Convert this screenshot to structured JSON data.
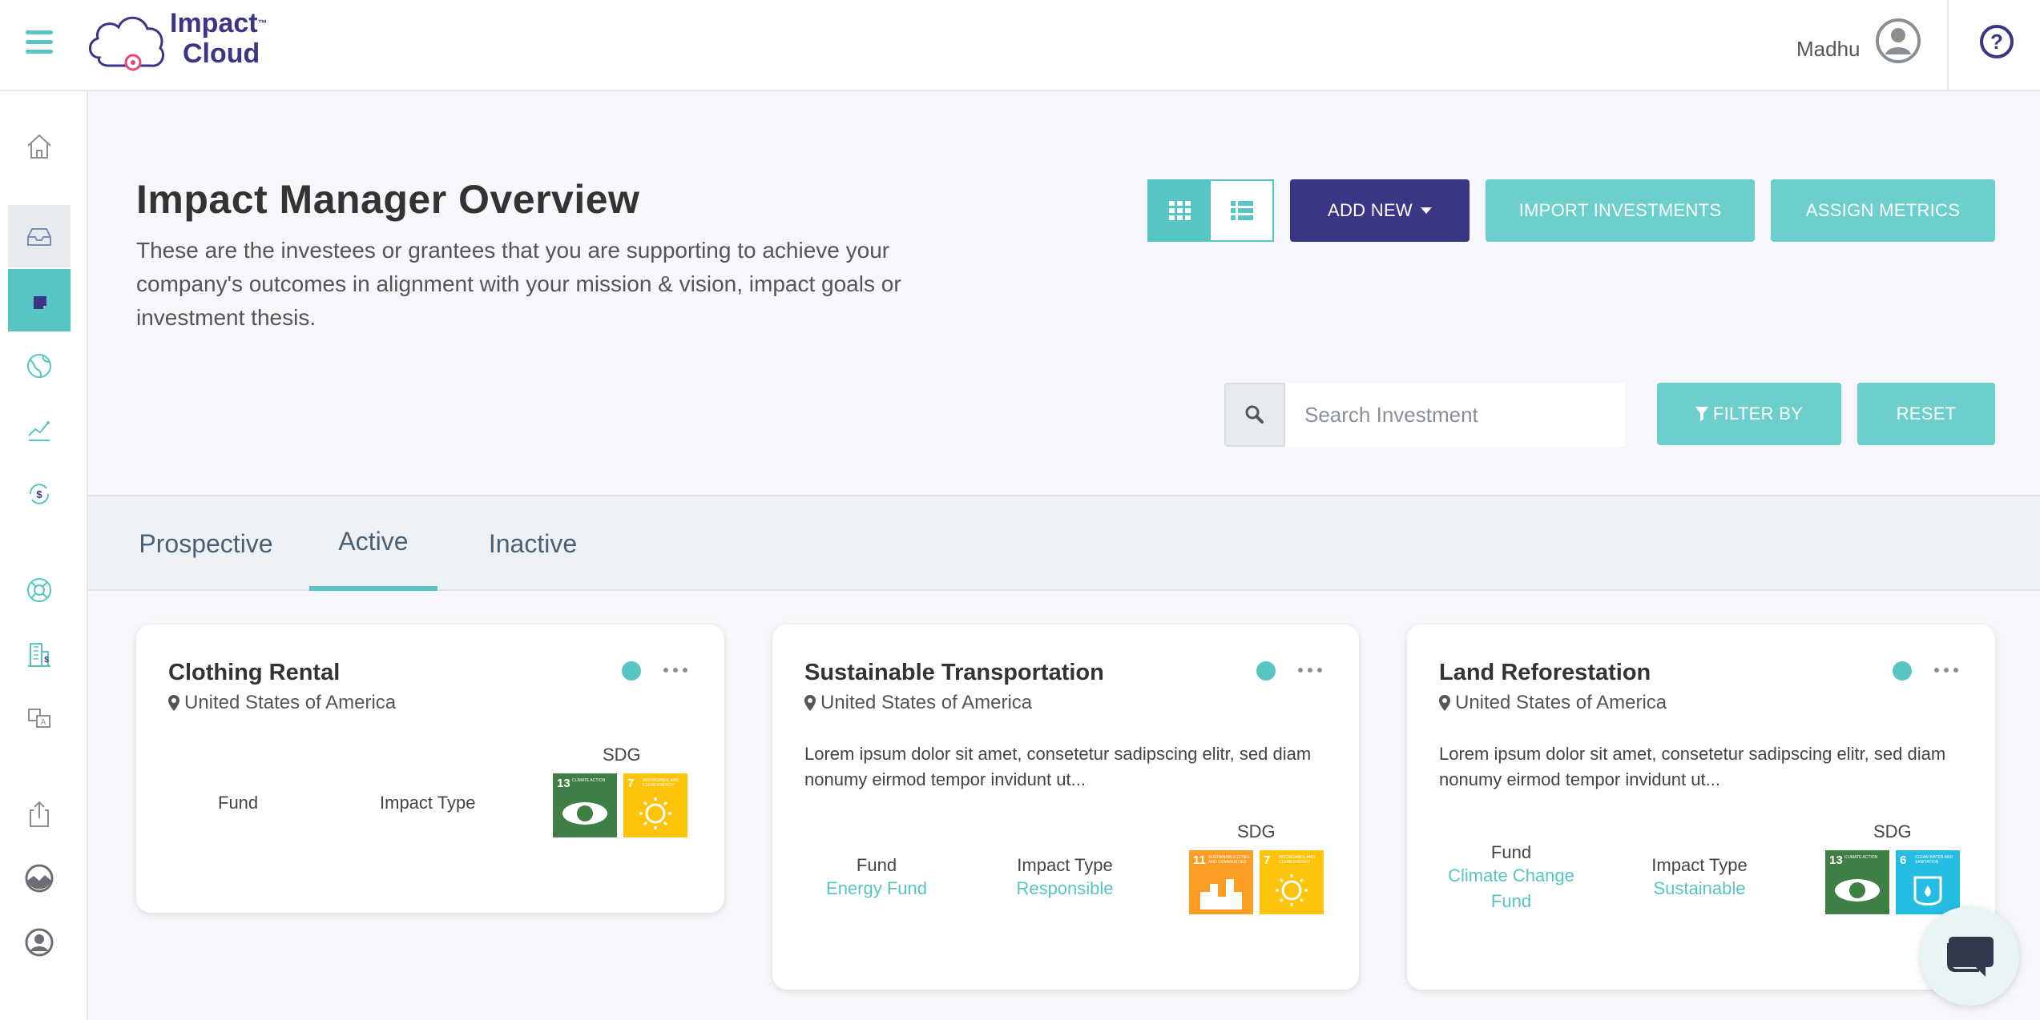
{
  "header": {
    "logo_line1": "Impact",
    "logo_line2": "Cloud",
    "logo_tm": "™",
    "user_name": "Madhu"
  },
  "sidebar": {
    "items": [
      {
        "icon": "home-icon"
      },
      {
        "icon": "inbox-icon"
      },
      {
        "icon": "document-icon"
      },
      {
        "icon": "globe-icon"
      },
      {
        "icon": "trend-chart-icon"
      },
      {
        "icon": "money-cycle-icon"
      },
      {
        "icon": "lifebuoy-icon"
      },
      {
        "icon": "building-icon"
      },
      {
        "icon": "translate-icon"
      },
      {
        "icon": "upload-icon"
      },
      {
        "icon": "landscape-icon"
      },
      {
        "icon": "profile-icon"
      }
    ],
    "active_index": 2
  },
  "page": {
    "title": "Impact Manager Overview",
    "description": "These are the investees or grantees that you are supporting to achieve your company's outcomes in alignment with your mission & vision, impact goals or investment thesis."
  },
  "toolbar": {
    "add_new_label": "ADD NEW",
    "import_label": "IMPORT INVESTMENTS",
    "assign_label": "ASSIGN METRICS",
    "filter_label": "FILTER BY",
    "reset_label": "RESET"
  },
  "search": {
    "placeholder": "Search Investment",
    "value": ""
  },
  "tabs": [
    {
      "label": "Prospective",
      "active": false
    },
    {
      "label": "Active",
      "active": true
    },
    {
      "label": "Inactive",
      "active": false
    }
  ],
  "cards": [
    {
      "title": "Clothing Rental",
      "location": "United States of America",
      "description": "",
      "fund_label": "Fund",
      "fund_value": "",
      "impact_label": "Impact Type",
      "impact_value": "",
      "sdg_label": "SDG",
      "sdgs": [
        {
          "num": "13",
          "text": "CLIMATE ACTION",
          "color": "#3f7e44",
          "icon": "eye-globe-icon"
        },
        {
          "num": "7",
          "text": "AFFORDABLE AND CLEAN ENERGY",
          "color": "#fcc30b",
          "icon": "sun-icon"
        }
      ]
    },
    {
      "title": "Sustainable Transportation",
      "location": "United States of America",
      "description": "Lorem ipsum dolor sit amet, consetetur sadipscing elitr, sed diam nonumy eirmod tempor invidunt ut...",
      "fund_label": "Fund",
      "fund_value": "Energy Fund",
      "impact_label": "Impact Type",
      "impact_value": "Responsible",
      "sdg_label": "SDG",
      "sdgs": [
        {
          "num": "11",
          "text": "SUSTAINABLE CITIES AND COMMUNITIES",
          "color": "#fd9d24",
          "icon": "city-icon"
        },
        {
          "num": "7",
          "text": "AFFORDABLE AND CLEAN ENERGY",
          "color": "#fcc30b",
          "icon": "sun-icon"
        }
      ]
    },
    {
      "title": "Land Reforestation",
      "location": "United States of America",
      "description": "Lorem ipsum dolor sit amet, consetetur sadipscing elitr, sed diam nonumy eirmod tempor invidunt ut...",
      "fund_label": "Fund",
      "fund_value": "Climate Change Fund",
      "impact_label": "Impact Type",
      "impact_value": "Sustainable",
      "sdg_label": "SDG",
      "sdgs": [
        {
          "num": "13",
          "text": "CLIMATE ACTION",
          "color": "#3f7e44",
          "icon": "eye-globe-icon"
        },
        {
          "num": "6",
          "text": "CLEAN WATER AND SANITATION",
          "color": "#26bde2",
          "icon": "water-icon"
        }
      ]
    }
  ],
  "colors": {
    "accent": "#57c5c3",
    "primary": "#3a3585",
    "button_light": "#6ccfcb"
  }
}
